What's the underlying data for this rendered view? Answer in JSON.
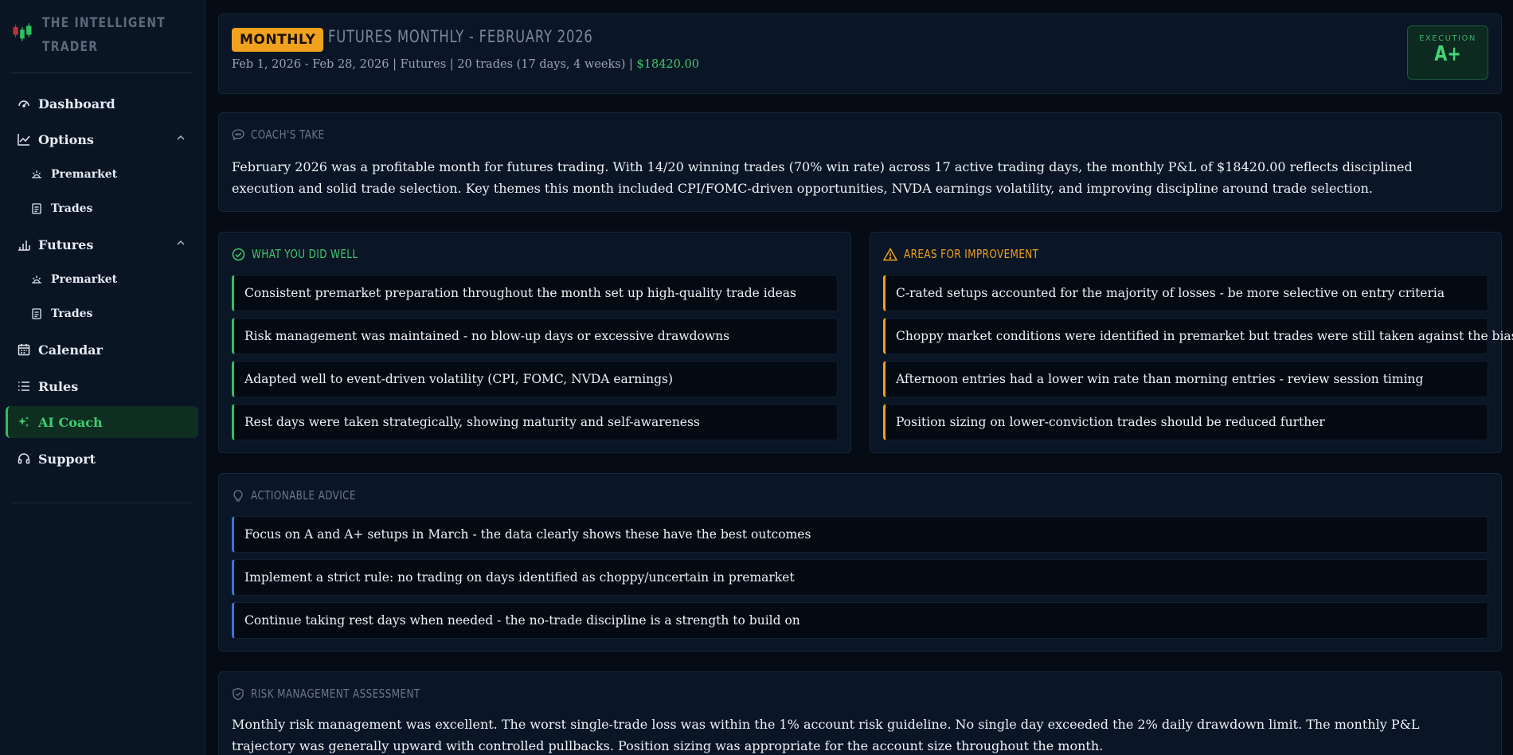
{
  "brand": {
    "line1": "THE INTELLIGENT",
    "line2": "TRADER"
  },
  "nav": {
    "dashboard": "Dashboard",
    "options": "Options",
    "options_premarket": "Premarket",
    "options_trades": "Trades",
    "futures": "Futures",
    "futures_premarket": "Premarket",
    "futures_trades": "Trades",
    "calendar": "Calendar",
    "rules": "Rules",
    "ai_coach": "AI Coach",
    "support": "Support"
  },
  "header": {
    "badge": "MONTHLY",
    "title": "FUTURES MONTHLY - FEBRUARY 2026",
    "meta": "Feb 1, 2026 - Feb 28, 2026 | Futures | 20 trades (17 days, 4 weeks) |",
    "pnl": "$18420.00",
    "grade_label": "EXECUTION",
    "grade": "A+"
  },
  "coach": {
    "title": "COACH'S TAKE",
    "text": "February 2026 was a profitable month for futures trading. With 14/20 winning trades (70% win rate) across 17 active trading days, the monthly P&L of $18420.00 reflects disciplined execution and solid trade selection. Key themes this month included CPI/FOMC-driven opportunities, NVDA earnings volatility, and improving discipline around trade selection."
  },
  "well": {
    "title": "WHAT YOU DID WELL",
    "items": [
      "Consistent premarket preparation throughout the month set up high-quality trade ideas",
      "Risk management was maintained - no blow-up days or excessive drawdowns",
      "Adapted well to event-driven volatility (CPI, FOMC, NVDA earnings)",
      "Rest days were taken strategically, showing maturity and self-awareness"
    ]
  },
  "improve": {
    "title": "AREAS FOR IMPROVEMENT",
    "items": [
      "C-rated setups accounted for the majority of losses - be more selective on entry criteria",
      "Choppy market conditions were identified in premarket but trades were still taken against the bias",
      "Afternoon entries had a lower win rate than morning entries - review session timing",
      "Position sizing on lower-conviction trades should be reduced further"
    ]
  },
  "advice": {
    "title": "ACTIONABLE ADVICE",
    "items": [
      "Focus on A and A+ setups in March - the data clearly shows these have the best outcomes",
      "Implement a strict rule: no trading on days identified as choppy/uncertain in premarket",
      "Continue taking rest days when needed - the no-trade discipline is a strength to build on"
    ]
  },
  "risk": {
    "title": "RISK MANAGEMENT ASSESSMENT",
    "text": "Monthly risk management was excellent. The worst single-trade loss was within the 1% account risk guideline. No single day exceeded the 2% daily drawdown limit. The monthly P&L trajectory was generally upward with controlled pullbacks. Position sizing was appropriate for the account size throughout the month."
  }
}
